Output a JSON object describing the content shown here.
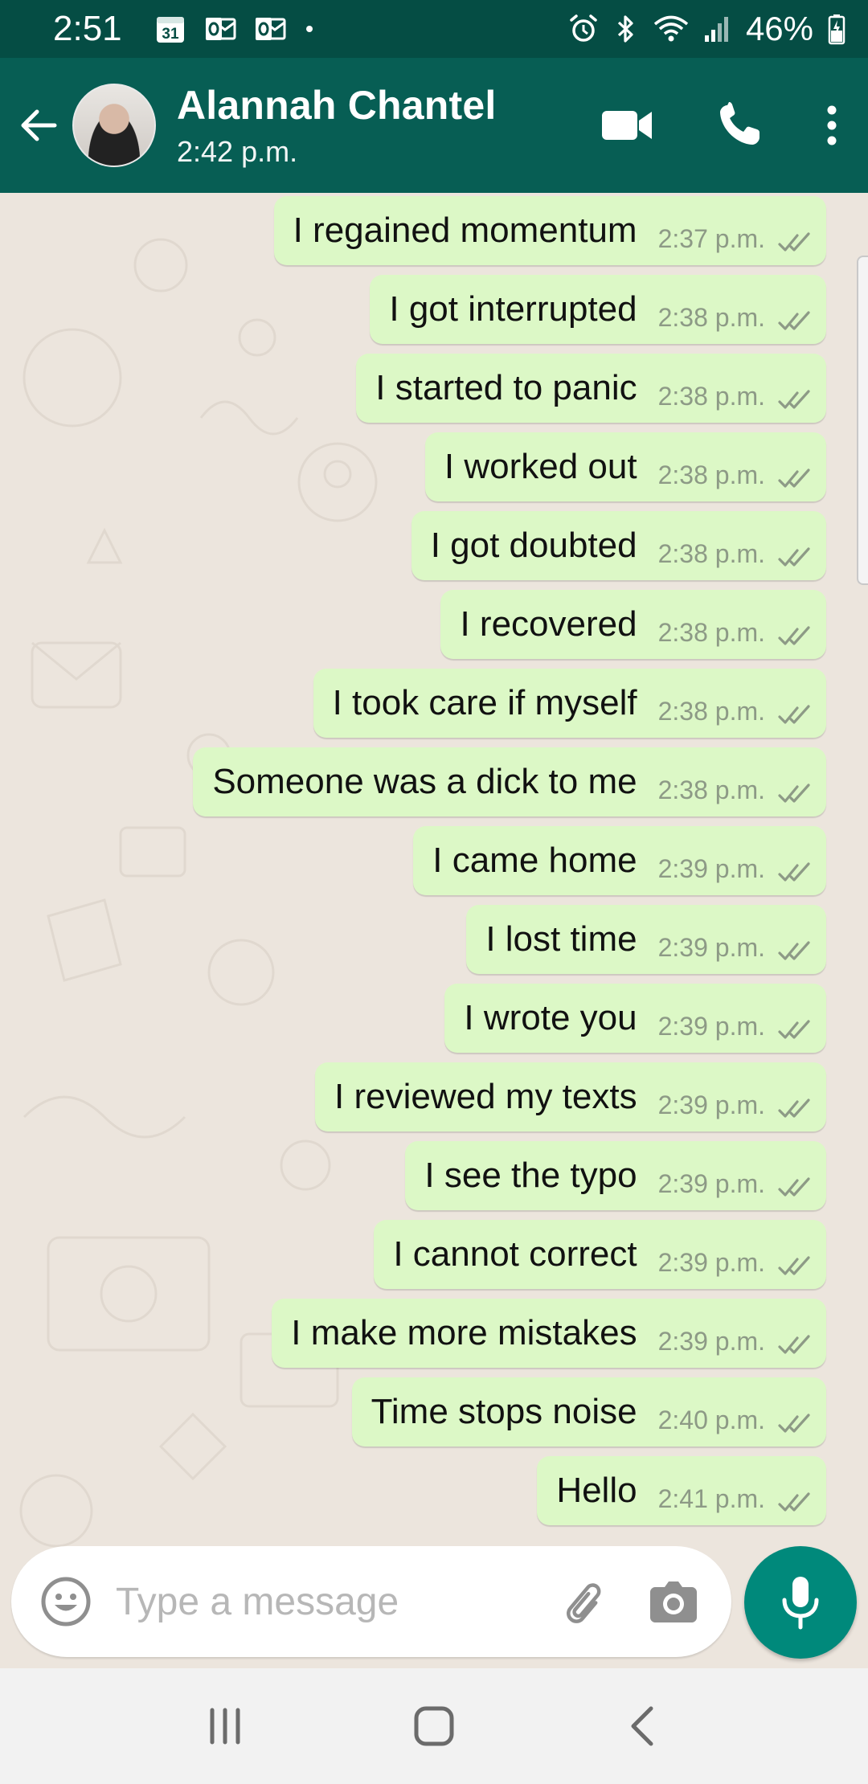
{
  "status_bar": {
    "time": "2:51",
    "calendar_day": "31",
    "battery_percent": "46%",
    "left_icons": [
      "calendar-icon",
      "outlook-icon",
      "outlook-icon",
      "dot-icon"
    ],
    "right_icons": [
      "alarm-icon",
      "bluetooth-icon",
      "wifi-icon",
      "signal-icon",
      "battery-icon"
    ]
  },
  "header": {
    "contact_name": "Alannah Chantel",
    "last_seen": "2:42 p.m.",
    "actions": [
      "video-call-icon",
      "voice-call-icon",
      "more-options-icon"
    ]
  },
  "messages": [
    {
      "text": "I regained momentum",
      "time": "2:37 p.m.",
      "read": true
    },
    {
      "text": "I got interrupted",
      "time": "2:38 p.m.",
      "read": true
    },
    {
      "text": "I started to panic",
      "time": "2:38 p.m.",
      "read": true
    },
    {
      "text": "I worked out",
      "time": "2:38 p.m.",
      "read": true
    },
    {
      "text": "I got doubted",
      "time": "2:38 p.m.",
      "read": true
    },
    {
      "text": "I recovered",
      "time": "2:38 p.m.",
      "read": true
    },
    {
      "text": "I took care if myself",
      "time": "2:38 p.m.",
      "read": true
    },
    {
      "text": "Someone was a dick to me",
      "time": "2:38 p.m.",
      "read": true
    },
    {
      "text": "I came home",
      "time": "2:39 p.m.",
      "read": true
    },
    {
      "text": "I lost time",
      "time": "2:39 p.m.",
      "read": true
    },
    {
      "text": "I wrote you",
      "time": "2:39 p.m.",
      "read": true
    },
    {
      "text": "I reviewed my texts",
      "time": "2:39 p.m.",
      "read": true
    },
    {
      "text": "I see the typo",
      "time": "2:39 p.m.",
      "read": true
    },
    {
      "text": "I cannot correct",
      "time": "2:39 p.m.",
      "read": true
    },
    {
      "text": "I make more mistakes",
      "time": "2:39 p.m.",
      "read": true
    },
    {
      "text": "Time stops noise",
      "time": "2:40 p.m.",
      "read": true
    },
    {
      "text": "Hello",
      "time": "2:41 p.m.",
      "read": true
    }
  ],
  "input": {
    "placeholder": "Type a message",
    "value": ""
  },
  "colors": {
    "header": "#075e54",
    "status_bar": "#054d44",
    "outgoing_bubble": "#dcf8c6",
    "chat_background": "#ece5dd",
    "mic_button": "#00897b",
    "nav_bar": "#f2f2f2"
  },
  "nav_bar": {
    "buttons": [
      "recent-apps-icon",
      "home-icon",
      "back-icon"
    ]
  }
}
